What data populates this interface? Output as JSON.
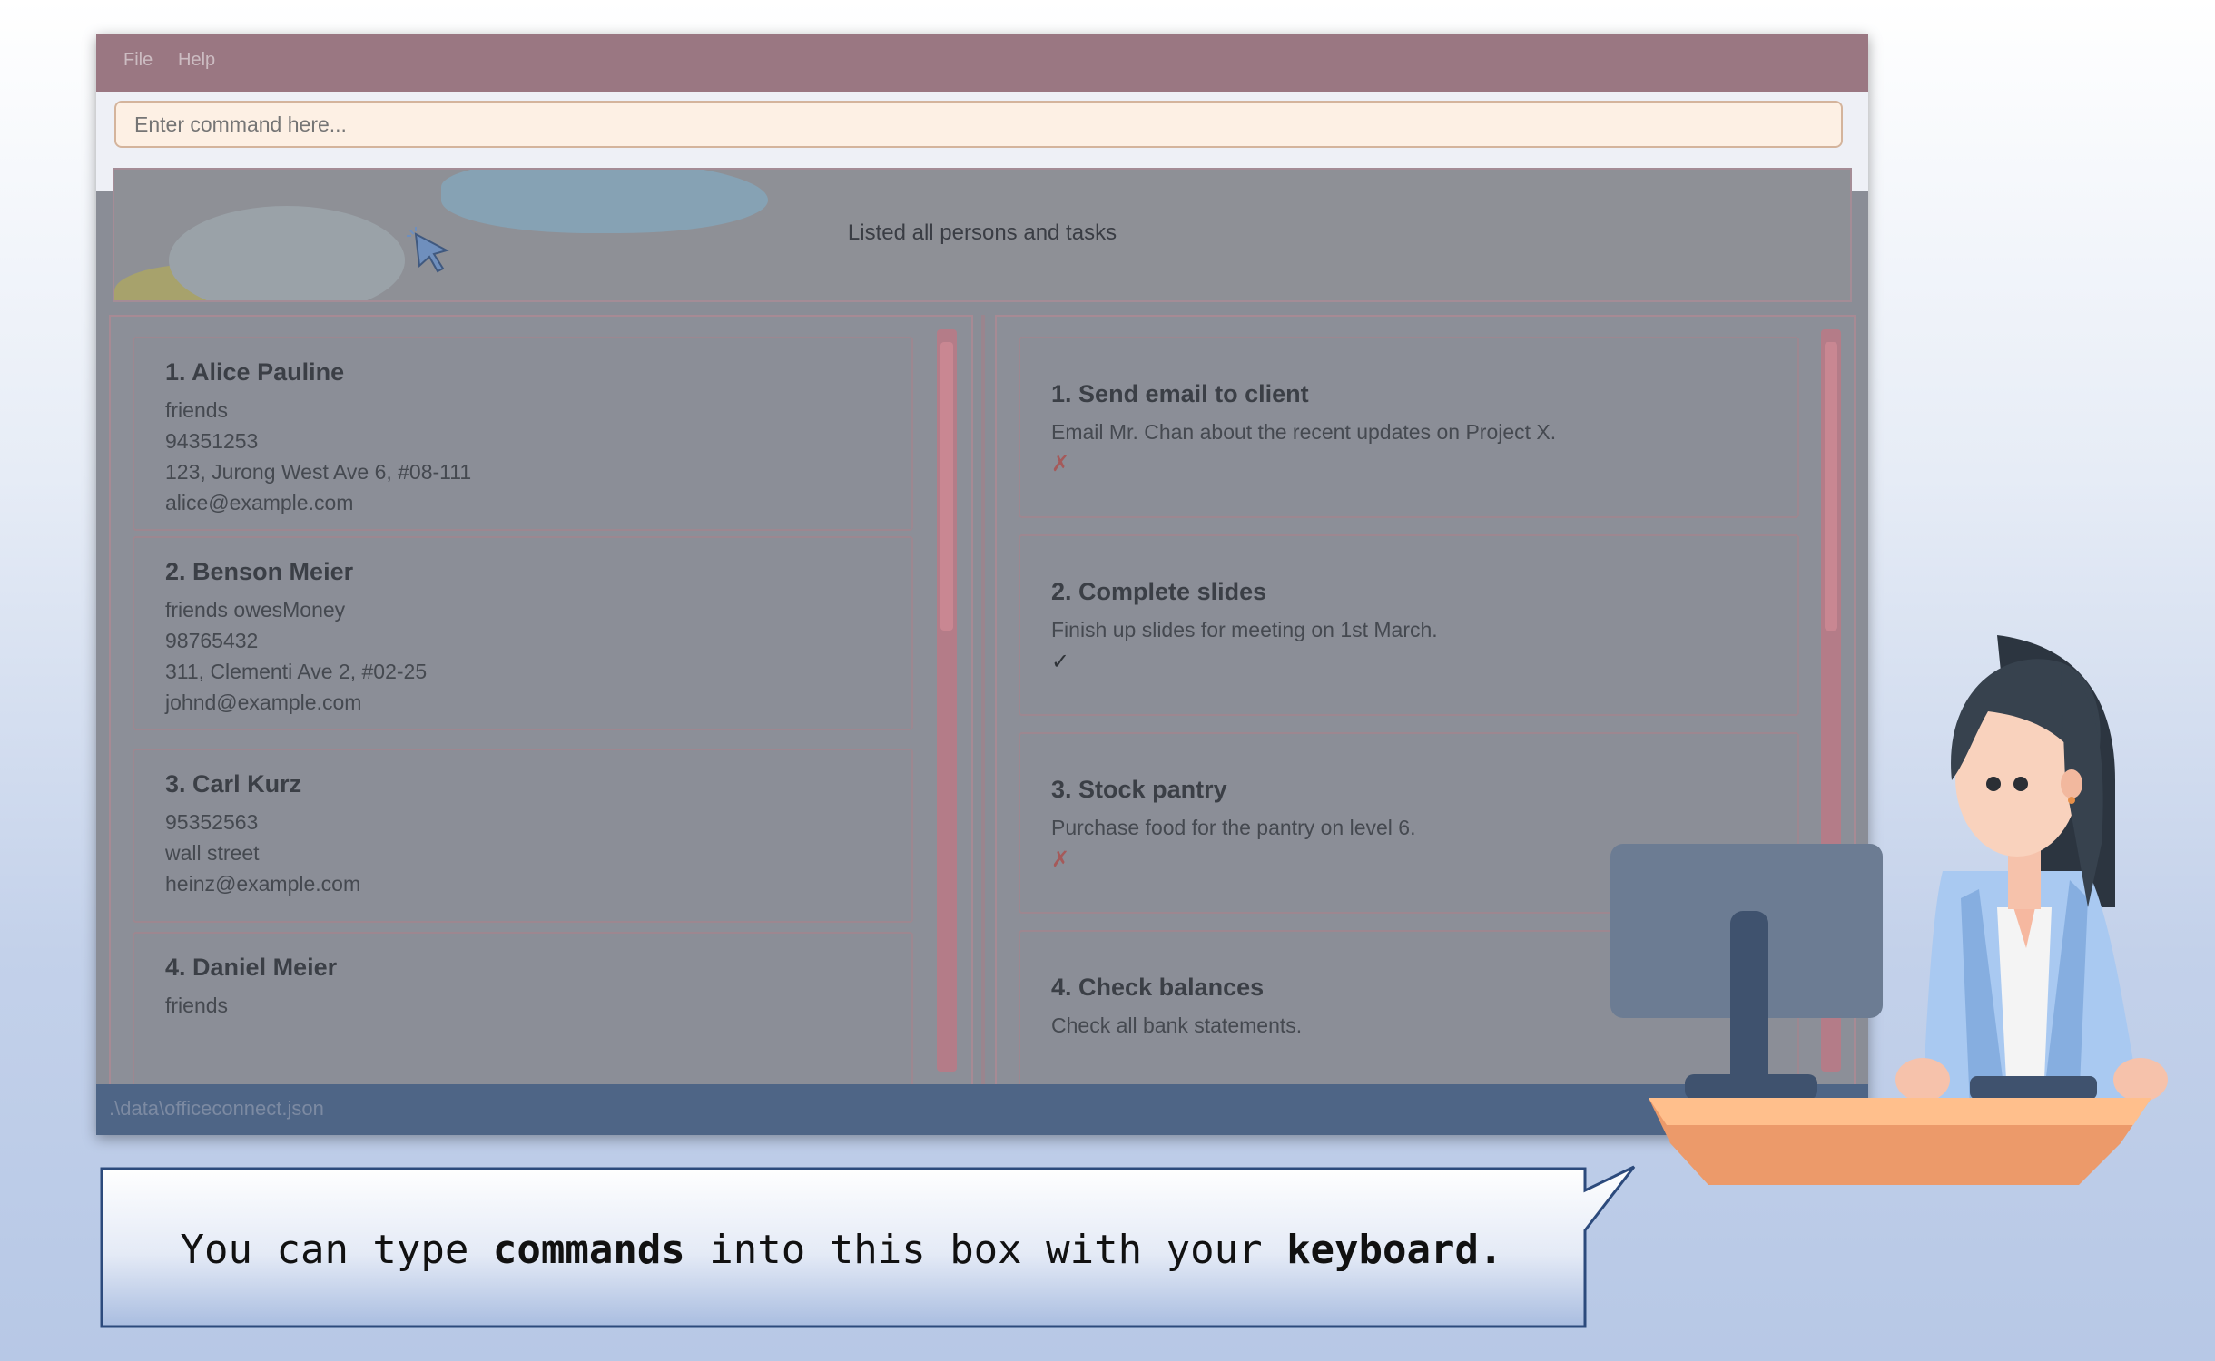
{
  "menu": {
    "file": "File",
    "help": "Help"
  },
  "command": {
    "placeholder": "Enter command here..."
  },
  "result": {
    "text": "Listed all persons and tasks"
  },
  "persons": [
    {
      "index": "1.",
      "name": "Alice Pauline",
      "lines": [
        "friends",
        "94351253",
        "123, Jurong West Ave 6, #08-111",
        "alice@example.com"
      ]
    },
    {
      "index": "2.",
      "name": "Benson Meier",
      "lines": [
        "friends  owesMoney",
        "98765432",
        "311, Clementi Ave 2, #02-25",
        "johnd@example.com"
      ]
    },
    {
      "index": "3.",
      "name": "Carl Kurz",
      "lines": [
        "95352563",
        "wall street",
        "heinz@example.com"
      ]
    },
    {
      "index": "4.",
      "name": "Daniel Meier",
      "lines": [
        "friends"
      ]
    }
  ],
  "tasks": [
    {
      "index": "1.",
      "title": "Send email to client",
      "desc": "Email Mr. Chan about the recent updates on Project X.",
      "mark": "✗",
      "done": false
    },
    {
      "index": "2.",
      "title": "Complete slides",
      "desc": "Finish up slides for meeting on 1st March.",
      "mark": "✓",
      "done": true
    },
    {
      "index": "3.",
      "title": "Stock pantry",
      "desc": "Purchase food for the pantry on level 6.",
      "mark": "✗",
      "done": false
    },
    {
      "index": "4.",
      "title": "Check balances",
      "desc": "Check all bank statements.",
      "mark": "",
      "done": false
    }
  ],
  "status": {
    "path": ".\\data\\officeconnect.json"
  },
  "tooltip": {
    "pre": "You can type ",
    "bold1": "commands",
    "mid": " into this box with your ",
    "bold2": "keyboard."
  },
  "icons": {
    "cursor": "mouse-pointer-icon",
    "character": "office-worker-illustration"
  },
  "colors": {
    "cross": "#a55a5a",
    "check": "#2f3338",
    "callout_border": "#2c4a7c"
  }
}
